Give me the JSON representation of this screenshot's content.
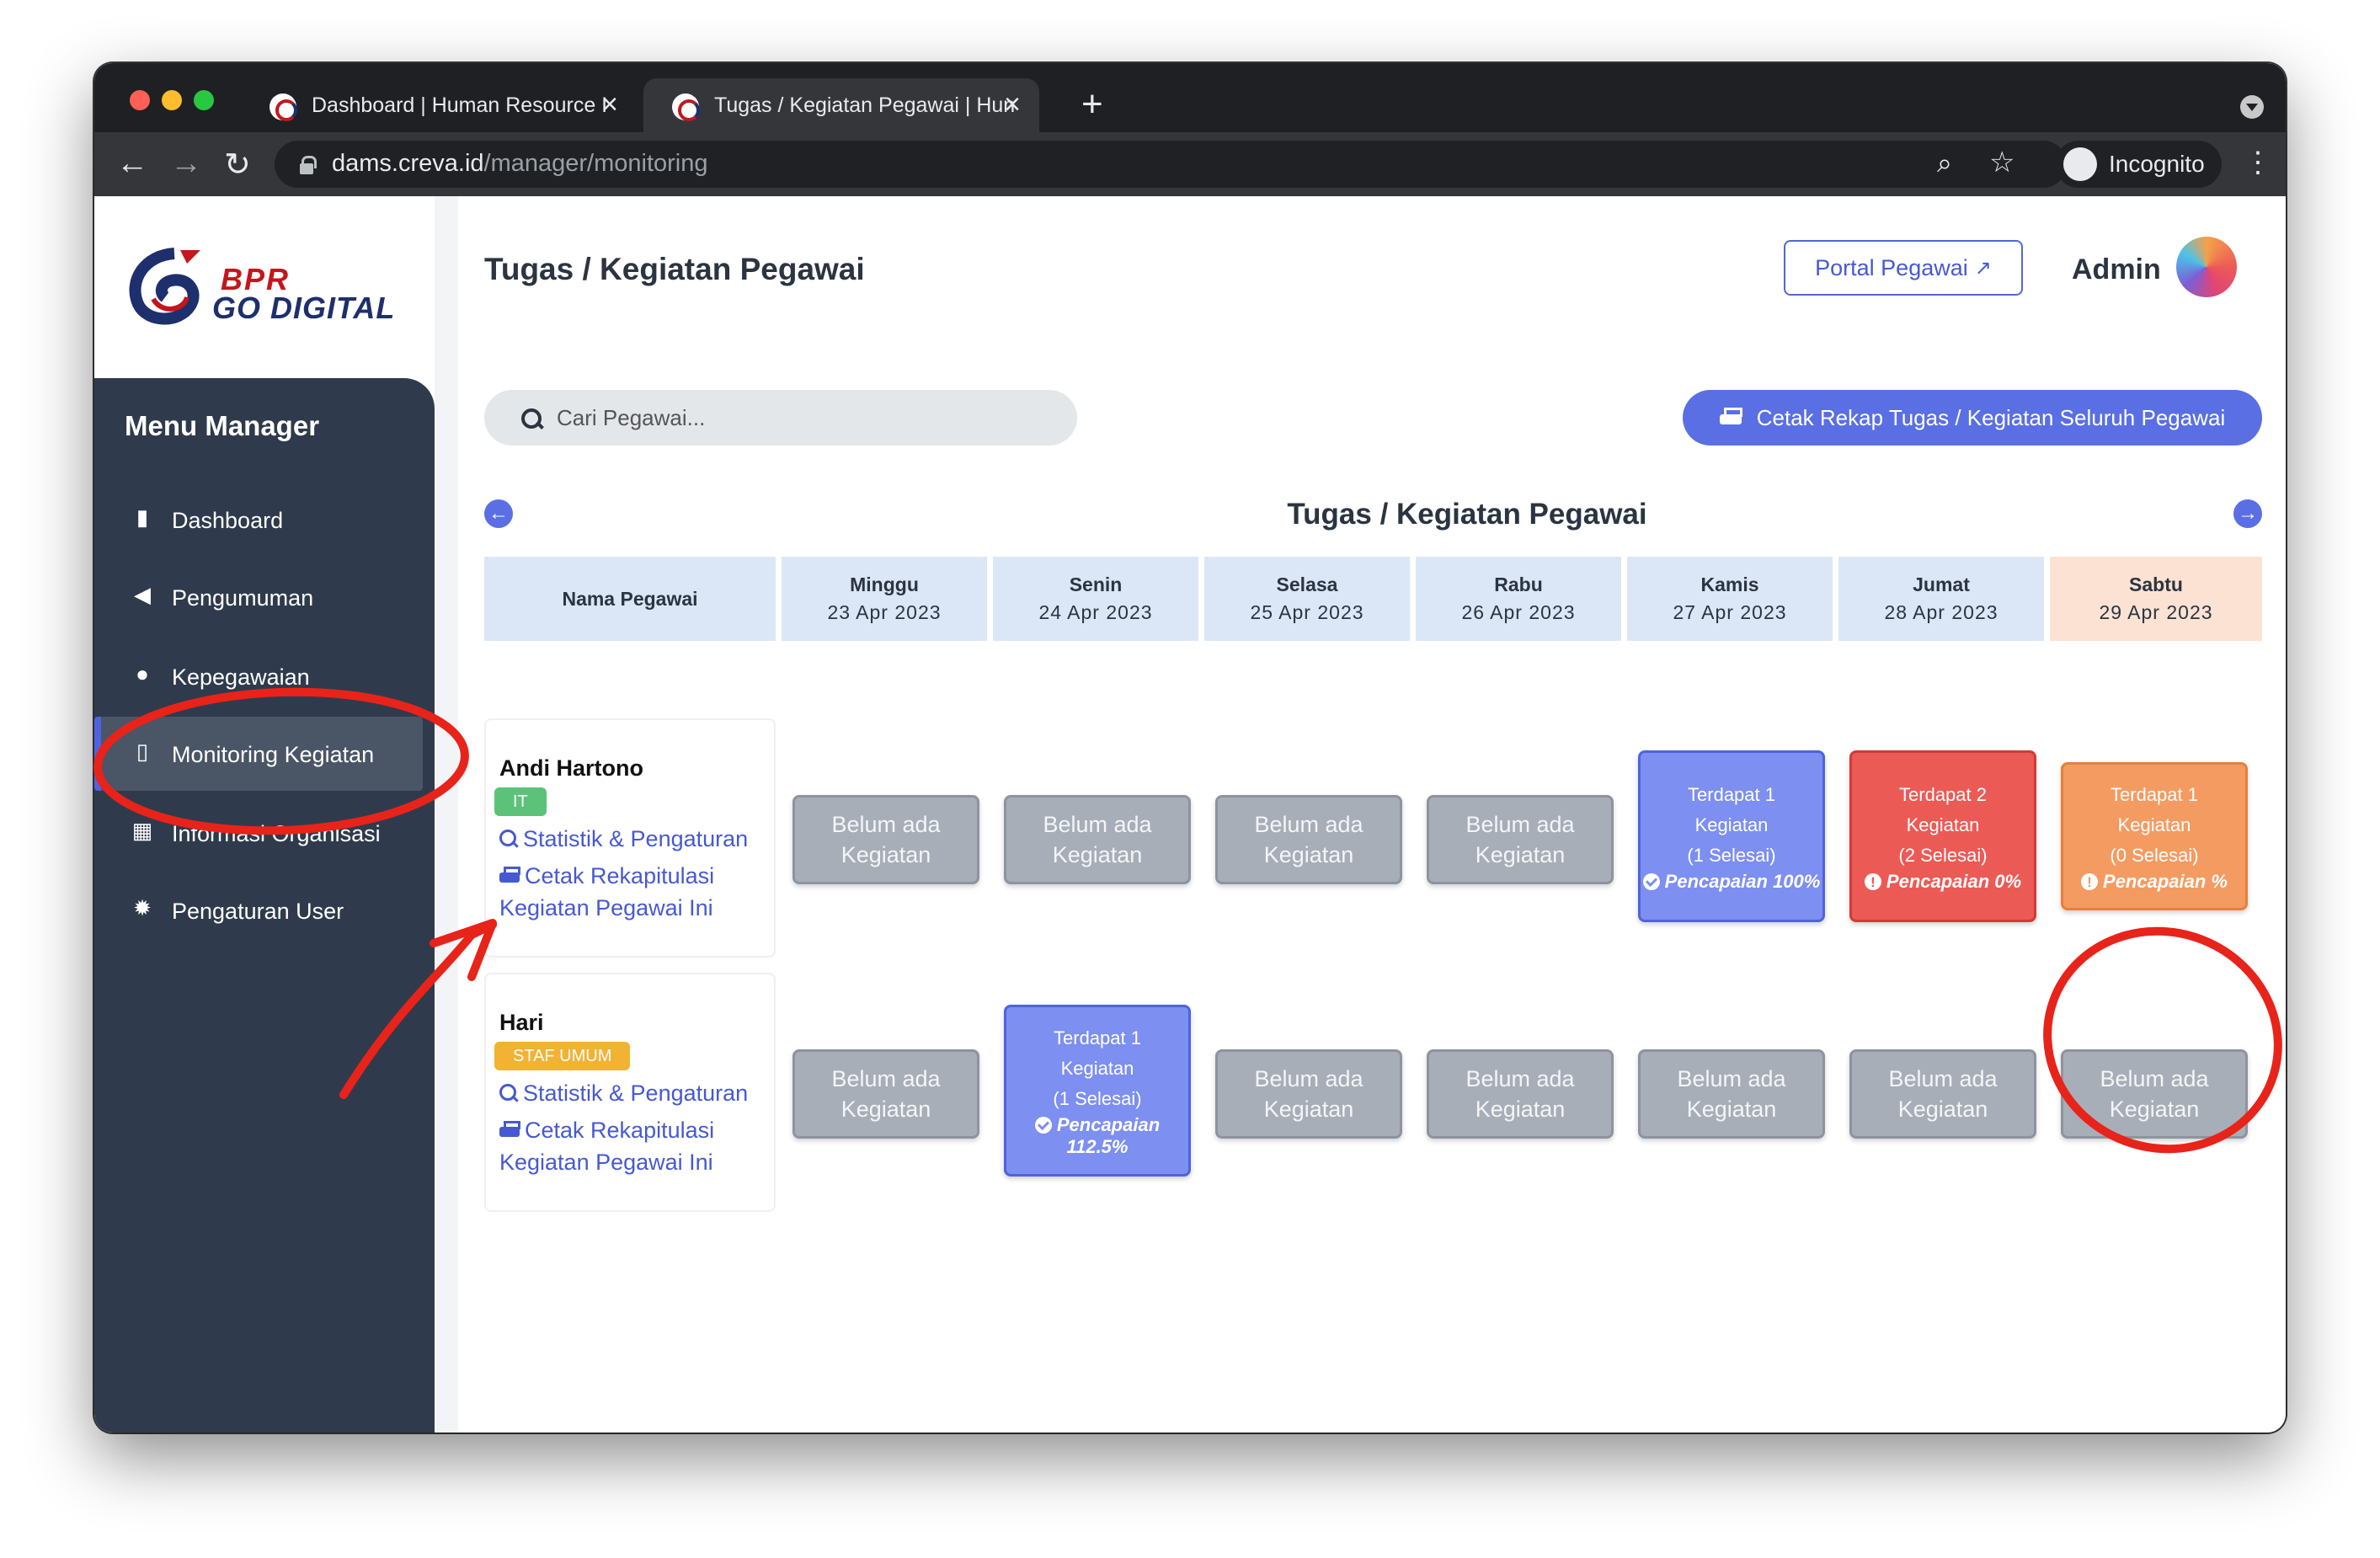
{
  "browser": {
    "tabs": [
      {
        "title": "Dashboard | Human Resource I",
        "active": false
      },
      {
        "title": "Tugas / Kegiatan Pegawai | Hun",
        "active": true
      }
    ],
    "url_host": "dams.creva.id",
    "url_path": "/manager/monitoring",
    "profile_label": "Incognito"
  },
  "logo": {
    "line1": "BPR",
    "line2": "GO DIGITAL"
  },
  "sidebar": {
    "title": "Menu Manager",
    "items": [
      {
        "label": "Dashboard",
        "icon": "clipboard-icon"
      },
      {
        "label": "Pengumuman",
        "icon": "megaphone-icon"
      },
      {
        "label": "Kepegawaian",
        "icon": "users-icon"
      },
      {
        "label": "Monitoring Kegiatan",
        "icon": "id-badge-icon",
        "active": true
      },
      {
        "label": "Informasi Organisasi",
        "icon": "building-icon"
      },
      {
        "label": "Pengaturan User",
        "icon": "gear-icon"
      }
    ]
  },
  "header": {
    "title": "Tugas / Kegiatan Pegawai",
    "portal_label": "Portal Pegawai",
    "admin_label": "Admin"
  },
  "search": {
    "placeholder": "Cari Pegawai..."
  },
  "print_all_label": "Cetak Rekap Tugas / Kegiatan Seluruh Pegawai",
  "schedule": {
    "title": "Tugas / Kegiatan Pegawai",
    "name_header": "Nama Pegawai",
    "days": [
      {
        "day": "Minggu",
        "date": "23 Apr 2023"
      },
      {
        "day": "Senin",
        "date": "24 Apr 2023"
      },
      {
        "day": "Selasa",
        "date": "25 Apr 2023"
      },
      {
        "day": "Rabu",
        "date": "26 Apr 2023"
      },
      {
        "day": "Kamis",
        "date": "27 Apr 2023"
      },
      {
        "day": "Jumat",
        "date": "28 Apr 2023"
      },
      {
        "day": "Sabtu",
        "date": "29 Apr 2023",
        "today": true
      }
    ],
    "employees": [
      {
        "name": "Andi Hartono",
        "badge": "IT",
        "badge_color": "#5cc27a",
        "link_stats": "Statistik & Pengaturan",
        "link_print_1": "Cetak Rekapitulasi",
        "link_print_2": "Kegiatan Pegawai Ini",
        "cells": [
          {
            "status": "empty",
            "line1": "Belum ada",
            "line2": "Kegiatan"
          },
          {
            "status": "empty",
            "line1": "Belum ada",
            "line2": "Kegiatan"
          },
          {
            "status": "empty",
            "line1": "Belum ada",
            "line2": "Kegiatan"
          },
          {
            "status": "empty",
            "line1": "Belum ada",
            "line2": "Kegiatan"
          },
          {
            "status": "blue",
            "line1": "Terdapat 1",
            "line2": "Kegiatan",
            "line3": "(1 Selesai)",
            "achievement": "Pencapaian 100%"
          },
          {
            "status": "red",
            "line1": "Terdapat 2",
            "line2": "Kegiatan",
            "line3": "(2 Selesai)",
            "achievement": "Pencapaian 0%"
          },
          {
            "status": "orange",
            "line1": "Terdapat 1",
            "line2": "Kegiatan",
            "line3": "(0 Selesai)",
            "achievement": "Pencapaian %"
          }
        ]
      },
      {
        "name": "Hari",
        "badge": "STAF UMUM",
        "badge_color": "#f2b233",
        "link_stats": "Statistik & Pengaturan",
        "link_print_1": "Cetak Rekapitulasi",
        "link_print_2": "Kegiatan Pegawai Ini",
        "cells": [
          {
            "status": "empty",
            "line1": "Belum ada",
            "line2": "Kegiatan"
          },
          {
            "status": "blue",
            "line1": "Terdapat 1",
            "line2": "Kegiatan",
            "line3": "(1 Selesai)",
            "achievement": "Pencapaian 112.5%"
          },
          {
            "status": "empty",
            "line1": "Belum ada",
            "line2": "Kegiatan"
          },
          {
            "status": "empty",
            "line1": "Belum ada",
            "line2": "Kegiatan"
          },
          {
            "status": "empty",
            "line1": "Belum ada",
            "line2": "Kegiatan"
          },
          {
            "status": "empty",
            "line1": "Belum ada",
            "line2": "Kegiatan"
          },
          {
            "status": "empty",
            "line1": "Belum ada",
            "line2": "Kegiatan"
          }
        ]
      }
    ]
  },
  "colors": {
    "accent": "#5a6fe3",
    "annotation": "#e8231a"
  }
}
